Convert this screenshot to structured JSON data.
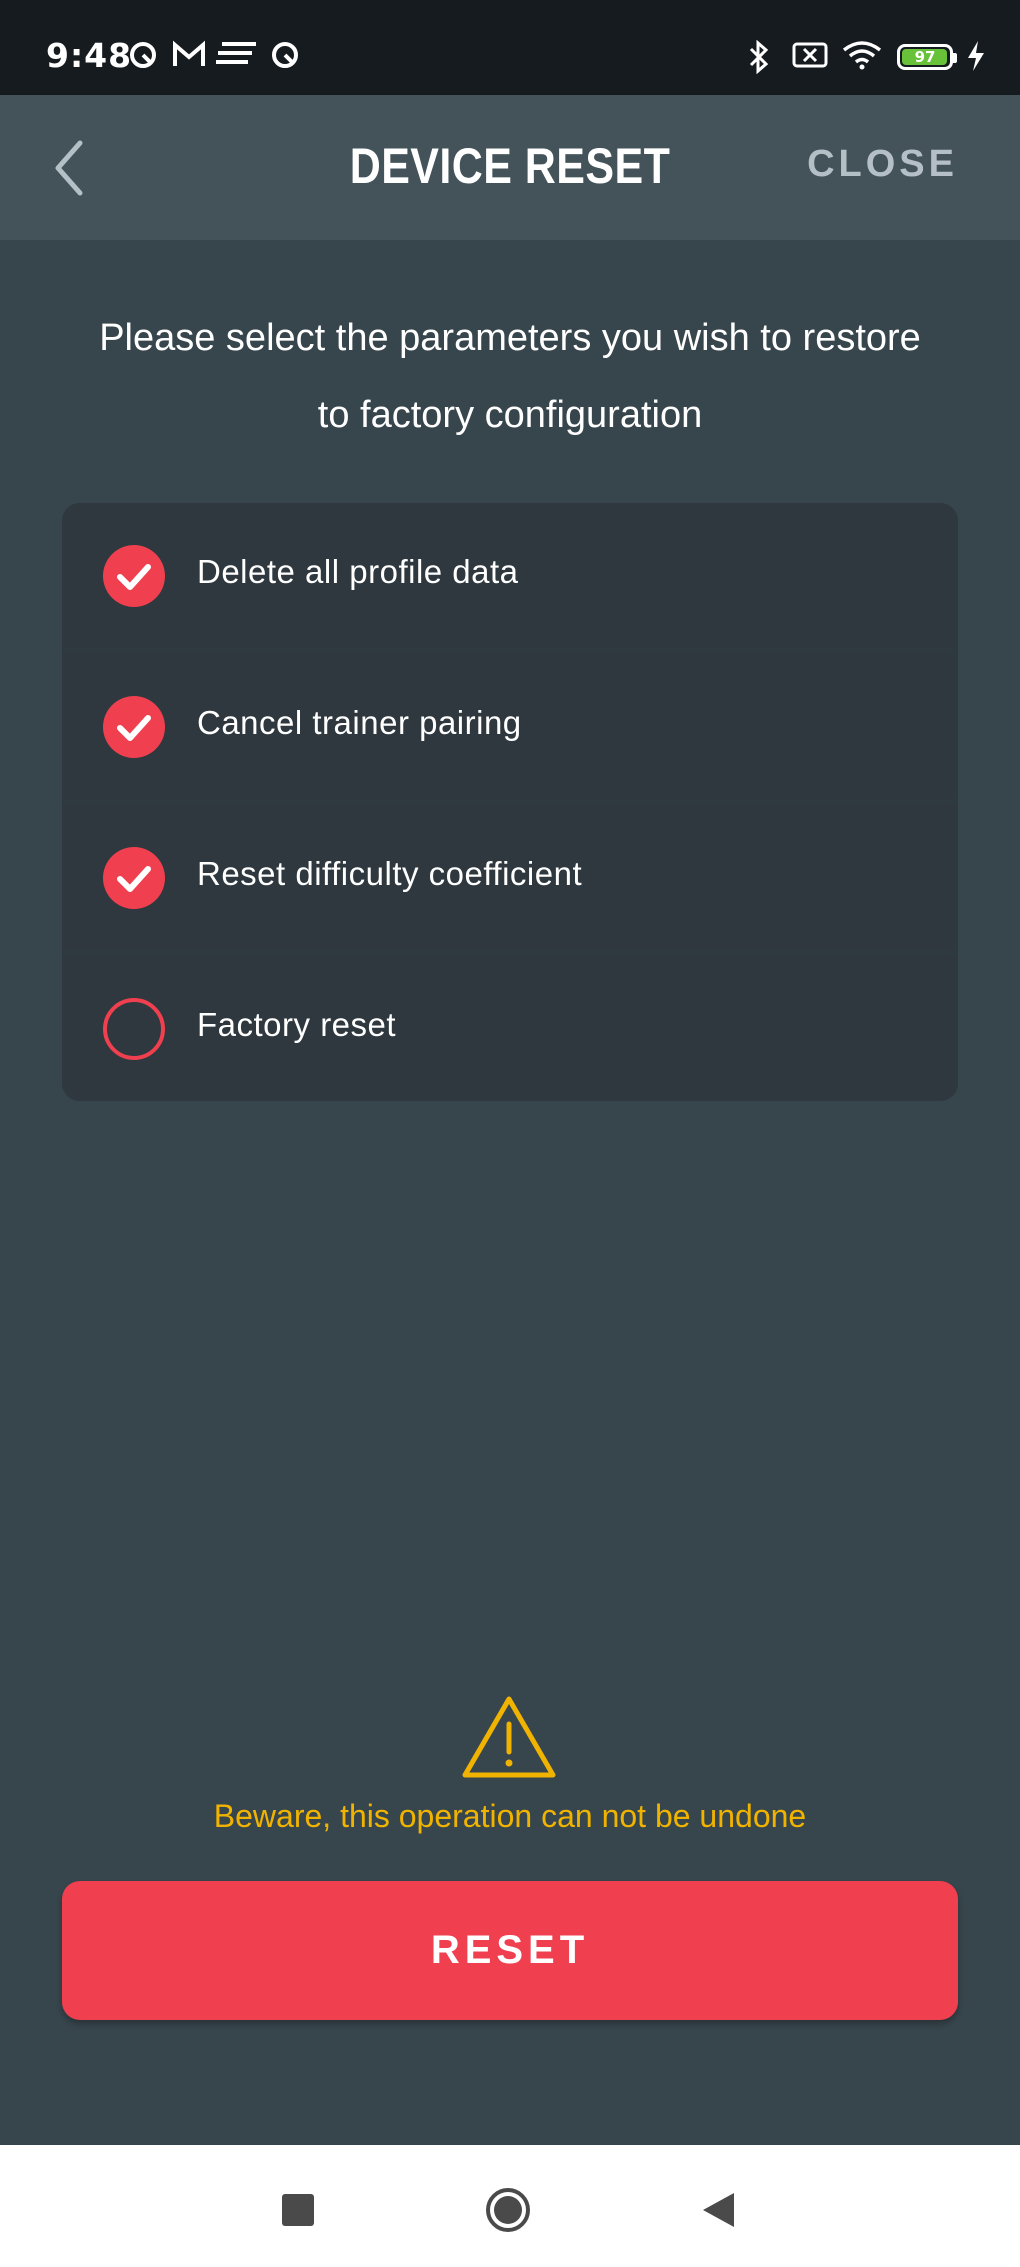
{
  "status_bar": {
    "time": "9:48",
    "battery_level": "97",
    "icons": [
      "app-notification-icon",
      "gmail-icon",
      "menu-lines-icon",
      "app-notification-icon",
      "bluetooth-icon",
      "no-sim-icon",
      "wifi-icon",
      "battery-icon",
      "charging-icon"
    ]
  },
  "header": {
    "title": "DEVICE RESET",
    "close_label": "CLOSE"
  },
  "instruction": "Please select the parameters you wish to restore to factory configuration",
  "options": [
    {
      "label": "Delete all profile data",
      "checked": true
    },
    {
      "label": "Cancel trainer pairing",
      "checked": true
    },
    {
      "label": "Reset difficulty coefficient",
      "checked": true
    },
    {
      "label": "Factory reset",
      "checked": false
    }
  ],
  "warning": "Beware, this operation can not be undone",
  "reset_label": "RESET",
  "colors": {
    "background": "#37454c",
    "header": "#435359",
    "accent": "#f0404f",
    "warning": "#f0b400"
  }
}
